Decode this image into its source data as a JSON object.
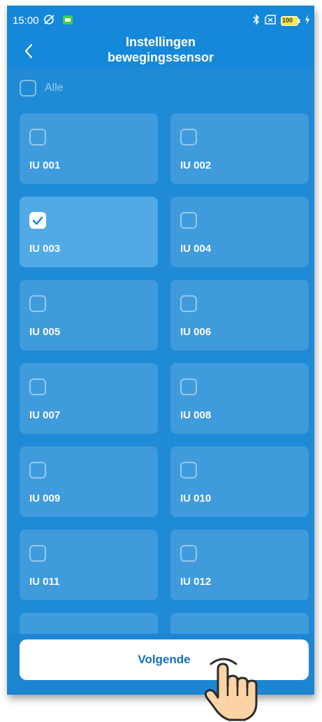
{
  "status_bar": {
    "time": "15:00",
    "battery": "100"
  },
  "header": {
    "title_line1": "Instellingen",
    "title_line2": "bewegingssensor"
  },
  "select_all": {
    "label": "Alle",
    "checked": false
  },
  "units": [
    {
      "label": "IU 001",
      "checked": false
    },
    {
      "label": "IU 002",
      "checked": false
    },
    {
      "label": "IU 003",
      "checked": true
    },
    {
      "label": "IU 004",
      "checked": false
    },
    {
      "label": "IU 005",
      "checked": false
    },
    {
      "label": "IU 006",
      "checked": false
    },
    {
      "label": "IU 007",
      "checked": false
    },
    {
      "label": "IU 008",
      "checked": false
    },
    {
      "label": "IU 009",
      "checked": false
    },
    {
      "label": "IU 010",
      "checked": false
    },
    {
      "label": "IU 011",
      "checked": false
    },
    {
      "label": "IU 012",
      "checked": false
    }
  ],
  "footer": {
    "next_label": "Volgende"
  },
  "colors": {
    "background": "#1a8bd9",
    "selected_card": "#51aae6",
    "button_text": "#1470c0"
  },
  "icons": [
    "back-arrow-icon",
    "alarm-off-icon",
    "app-notification-icon",
    "bluetooth-icon",
    "no-sim-icon",
    "battery-icon",
    "charging-icon",
    "checkmark-icon",
    "hand-pointer-icon"
  ]
}
